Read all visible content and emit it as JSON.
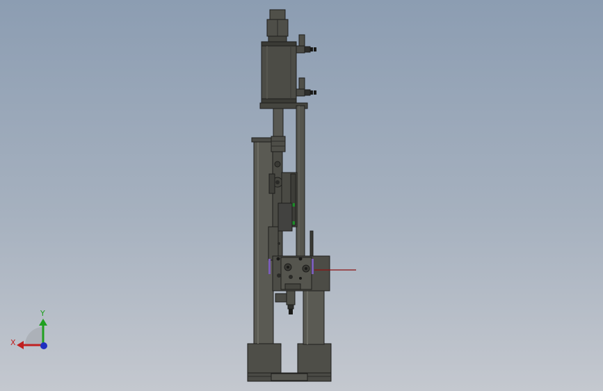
{
  "viewport": {
    "background_top": "#8c9db2",
    "background_bottom": "#c4c8cf"
  },
  "model": {
    "description_icon": "pneumatic-cylinder-assembly",
    "body_color": "#4e4e48",
    "dark_color": "#2f2f2c",
    "accent_green": "#1e8a2a",
    "accent_purple": "#7a5db8",
    "accent_red": "#8b1010"
  },
  "triad": {
    "x_label": "X",
    "y_label": "Y",
    "x_color": "#c02020",
    "y_color": "#20a020",
    "z_color": "#2030c0"
  }
}
